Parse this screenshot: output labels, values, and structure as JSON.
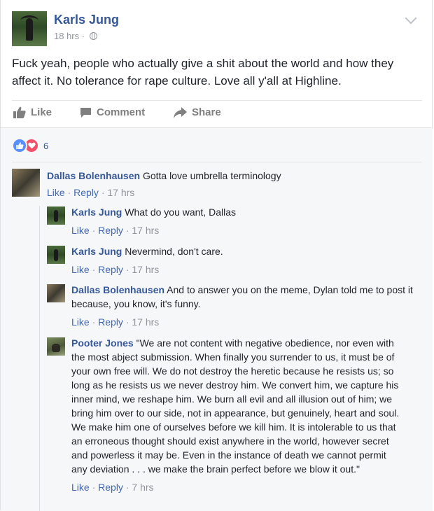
{
  "post": {
    "author": "Karls Jung",
    "time": "18 hrs",
    "separator": "·",
    "text": "Fuck yeah, people who actually give a shit about the world and how they affect it. No tolerance for rape culture. Love all y'all at Highline."
  },
  "actions": {
    "like": "Like",
    "comment": "Comment",
    "share": "Share"
  },
  "reactions": {
    "count": "6",
    "types": [
      "like",
      "love"
    ]
  },
  "comments": [
    {
      "author": "Dallas Bolenhausen",
      "text": "Gotta love umbrella terminology",
      "like": "Like",
      "reply": "Reply",
      "sep": "·",
      "time": "17 hrs"
    },
    {
      "author": "Karls Jung",
      "text": "What do you want, Dallas",
      "like": "Like",
      "reply": "Reply",
      "sep": "·",
      "time": "17 hrs"
    },
    {
      "author": "Karls Jung",
      "text": "Nevermind, don't care.",
      "like": "Like",
      "reply": "Reply",
      "sep": "·",
      "time": "17 hrs"
    },
    {
      "author": "Dallas Bolenhausen",
      "text": "And to answer you on the meme, Dylan told me to post it because, you know, it's funny.",
      "like": "Like",
      "reply": "Reply",
      "sep": "·",
      "time": "17 hrs"
    },
    {
      "author": "Pooter Jones",
      "text": "\"We are not content with negative obedience, nor even with the most abject submission. When finally you surrender to us, it must be of your own free will. We do not destroy the heretic because he resists us; so long as he resists us we never destroy him. We convert him, we capture his inner mind, we reshape him. We burn all evil and all illusion out of him; we bring him over to our side, not in appearance, but genuinely, heart and soul. We make him one of ourselves before we kill him. It is intolerable to us that an erroneous thought should exist anywhere in the world, however secret and powerless it may be. Even in the instance of death we cannot permit any deviation . . . we make the brain perfect before we blow it out.\"",
      "like": "Like",
      "reply": "Reply",
      "sep": "·",
      "time": "7 hrs"
    }
  ],
  "colors": {
    "link": "#365899",
    "action_link": "#4267b2",
    "meta": "#90949c",
    "like_reaction": "#5890ff",
    "love_reaction": "#f25268",
    "comments_bg": "#f6f7f9"
  }
}
